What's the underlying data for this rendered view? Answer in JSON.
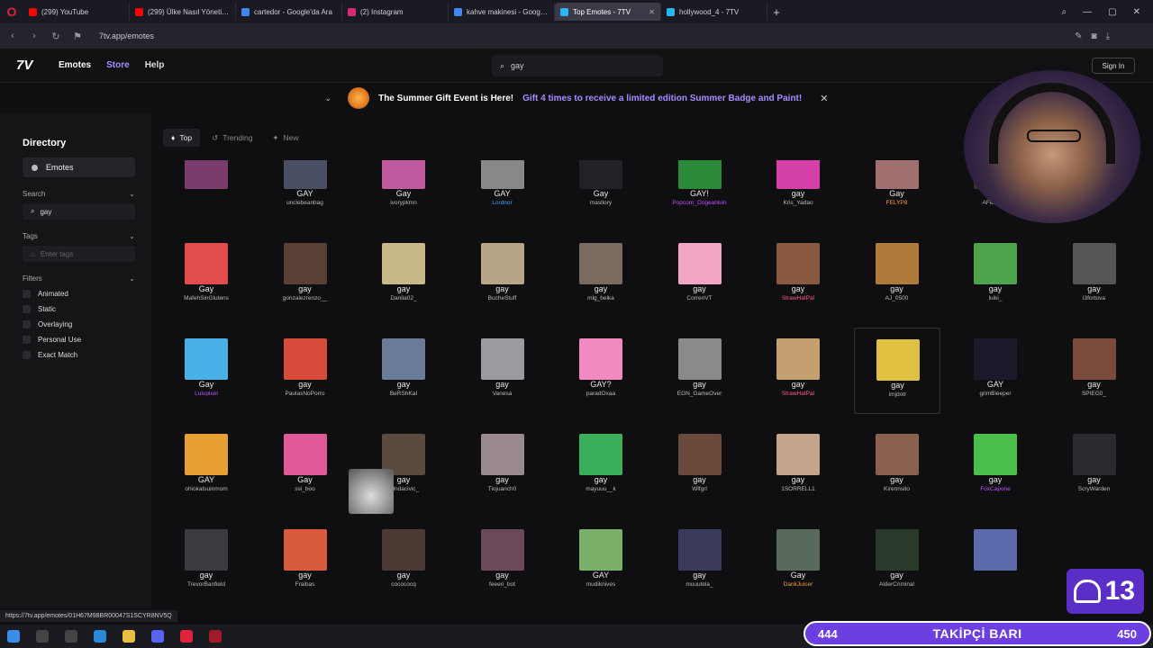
{
  "browser": {
    "tabs": [
      {
        "title": "(299) YouTube",
        "color": "#ff0000",
        "active": false
      },
      {
        "title": "(299) Ülke Nasıl Yönetilme",
        "color": "#ff0000",
        "active": false
      },
      {
        "title": "cartedor - Google'da Ara",
        "color": "#4285f4",
        "active": false
      },
      {
        "title": "(2) Instagram",
        "color": "#d62976",
        "active": false
      },
      {
        "title": "kahve makinesi - Google'da",
        "color": "#4285f4",
        "active": false
      },
      {
        "title": "Top Emotes - 7TV",
        "color": "#29b6f6",
        "active": true
      },
      {
        "title": "hollywood_4 - 7TV",
        "color": "#29b6f6",
        "active": false
      }
    ],
    "url": "7tv.app/emotes",
    "status_url": "https://7tv.app/emotes/01H67M98BR00047S1SCYR8NV5Q"
  },
  "header": {
    "logo": "7V",
    "nav": [
      {
        "label": "Emotes",
        "color": "#ffffff"
      },
      {
        "label": "Store",
        "color": "#a68cff"
      },
      {
        "label": "Help",
        "color": "#dddddd"
      }
    ],
    "search_value": "gay",
    "signin_label": "Sign In"
  },
  "banner": {
    "title": "The Summer Gift Event is Here!",
    "link": "Gift 4 times to receive a limited edition Summer Badge and Paint!"
  },
  "sidebar": {
    "title": "Directory",
    "active_item": "Emotes",
    "search_label": "Search",
    "search_value": "gay",
    "tags_label": "Tags",
    "tags_placeholder": "Enter tags",
    "filters_label": "Filters",
    "filters": [
      "Animated",
      "Static",
      "Overlaying",
      "Personal Use",
      "Exact Match"
    ]
  },
  "sort_tabs": [
    "Top",
    "Trending",
    "New"
  ],
  "emotes": [
    {
      "name": "",
      "owner": "",
      "color": "#7a3d6b"
    },
    {
      "name": "GAY",
      "owner": "unclebeanbag",
      "color": "#4a4f63"
    },
    {
      "name": "Gay",
      "owner": "ivorypkmn",
      "color": "#c25aa0"
    },
    {
      "name": "GAY",
      "owner": "Lordnor",
      "owner_color": "#3aa0ff",
      "color": "#888888"
    },
    {
      "name": "Gay",
      "owner": "masllory",
      "color": "#222226"
    },
    {
      "name": "GAY!",
      "owner": "Popcorn_Dogeahkiin",
      "owner_color": "#c04dff",
      "color": "#2a8a3a"
    },
    {
      "name": "gay",
      "owner": "Kris_Yadao",
      "color": "#d43fa8"
    },
    {
      "name": "Gay",
      "owner": "FELYP8",
      "owner_color": "#ff9b2e",
      "color": "#a07070"
    },
    {
      "name": "",
      "owner": "AFiddles_",
      "color": "#333"
    },
    {
      "name": "gay",
      "owner": "el_chizza",
      "color": "#6e5a4a"
    },
    {
      "name": "Gay",
      "owner": "MafehSinGlutens",
      "color": "#e24c4c"
    },
    {
      "name": "gay",
      "owner": "gonzalezrenzo__",
      "color": "#5a3f34"
    },
    {
      "name": "gay",
      "owner": "Danila02_",
      "color": "#c9b98a"
    },
    {
      "name": "gay",
      "owner": "BucheStuff",
      "color": "#b7a585"
    },
    {
      "name": "gay",
      "owner": "mlg_belka",
      "color": "#7a6a60"
    },
    {
      "name": "gay",
      "owner": "CorrenVT",
      "color": "#f0a6c4"
    },
    {
      "name": "gay",
      "owner": "StrawHatPal",
      "owner_color": "#ff5a8a",
      "color": "#8a5a40"
    },
    {
      "name": "gay",
      "owner": "AJ_0500",
      "color": "#b07a3a"
    },
    {
      "name": "gay",
      "owner": "luiki_",
      "color": "#4fa34a"
    },
    {
      "name": "gay",
      "owner": "l3fortova",
      "color": "#555"
    },
    {
      "name": "Gay",
      "owner": "Lulupixel",
      "owner_color": "#c04dff",
      "color": "#4ab0e8"
    },
    {
      "name": "gay",
      "owner": "PaulasNoPorro",
      "color": "#d84a3a"
    },
    {
      "name": "gay",
      "owner": "BeRShKaI",
      "color": "#6a7a9a"
    },
    {
      "name": "gay",
      "owner": "Vanesa",
      "color": "#9a9aa0"
    },
    {
      "name": "GAY?",
      "owner": "paradOxaa",
      "color": "#f08ac0"
    },
    {
      "name": "gay",
      "owner": "EGN_GameOver",
      "color": "#8a8a8a"
    },
    {
      "name": "gay",
      "owner": "StrawHatPal",
      "owner_color": "#ff5a8a",
      "color": "#c4a070"
    },
    {
      "name": "gay",
      "owner": "imjdotr",
      "color": "#e0c040",
      "outlined": true
    },
    {
      "name": "GAY",
      "owner": "grimBleeper",
      "color": "#1a1a2a"
    },
    {
      "name": "gay",
      "owner": "SPIEG0_",
      "color": "#7a4a3a"
    },
    {
      "name": "GAY",
      "owner": "ohiokatsuinmom",
      "color": "#e8a030"
    },
    {
      "name": "Gay",
      "owner": "ssi_boo",
      "color": "#e05a9a"
    },
    {
      "name": "gay",
      "owner": "h0ndacivic_",
      "color": "#5a4a40"
    },
    {
      "name": "gay",
      "owner": "Tiojuanch0",
      "color": "#9a8a90"
    },
    {
      "name": "gay",
      "owner": "mayuuu__k",
      "color": "#3ab05a"
    },
    {
      "name": "gay",
      "owner": "Wlfgrl",
      "color": "#6a4a3a"
    },
    {
      "name": "gay",
      "owner": "1SORRELL1",
      "color": "#c4a48a"
    },
    {
      "name": "gay",
      "owner": "Kirennsito",
      "color": "#8a6050"
    },
    {
      "name": "gay",
      "owner": "FoxCapone",
      "owner_color": "#c04dff",
      "color": "#4ac04a"
    },
    {
      "name": "gay",
      "owner": "ScryWarden",
      "color": "#2a2a30"
    },
    {
      "name": "gay",
      "owner": "TrevorBanfield",
      "color": "#3a3a40"
    },
    {
      "name": "gay",
      "owner": "Fraibas",
      "color": "#d85a3a"
    },
    {
      "name": "gay",
      "owner": "cocococq",
      "color": "#4a3a34"
    },
    {
      "name": "gay",
      "owner": "feeeri_bot",
      "color": "#6a4a5a"
    },
    {
      "name": "GAY",
      "owner": "mudiknives",
      "color": "#7ab06a"
    },
    {
      "name": "gay",
      "owner": "muuutela_",
      "color": "#3a3a5a"
    },
    {
      "name": "Gay",
      "owner": "DankJuicer",
      "owner_color": "#ff9b2e",
      "color": "#5a6a5a"
    },
    {
      "name": "gay",
      "owner": "AlderCriminal",
      "color": "#2a3a2a"
    },
    {
      "name": "",
      "owner": "",
      "color": "#5a6aaa"
    }
  ],
  "overlay": {
    "viewers": "13",
    "follow_start": "444",
    "follow_label": "TAKİPÇİ BARI",
    "follow_end": "450"
  }
}
